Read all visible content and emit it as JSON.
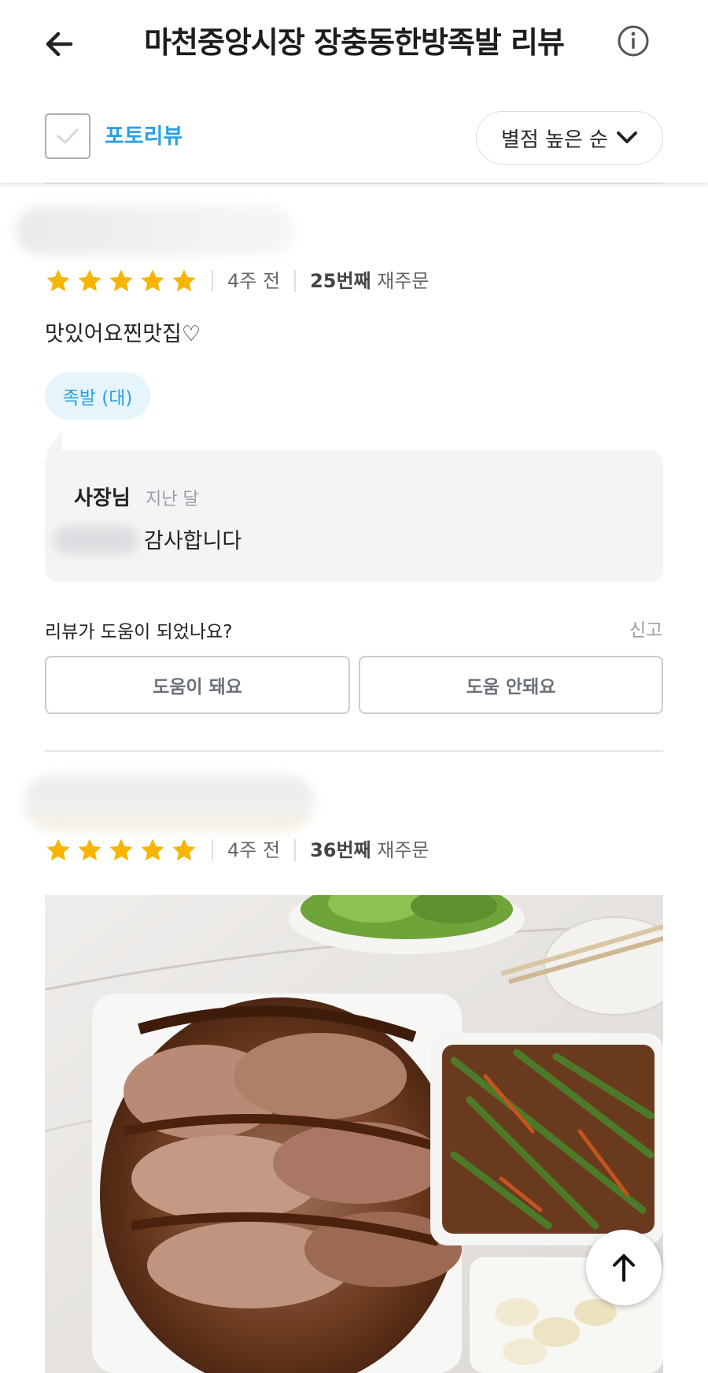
{
  "header": {
    "title": "마천중앙시장 장충동한방족발 리뷰",
    "back_icon": "arrow-left-icon",
    "info_icon": "info-circle-icon"
  },
  "filter": {
    "photo_review_label": "포토리뷰",
    "photo_review_checked": false,
    "sort_label": "별점 높은 순"
  },
  "colors": {
    "accent": "#2ba0e3",
    "star": "#f7b500",
    "owner_bg": "#f3f4f6"
  },
  "reviews": [
    {
      "rating": 5,
      "date": "4주 전",
      "reorder_count": "25번째",
      "reorder_suffix": "재주문",
      "text": "맛있어요찐맛집♡",
      "menu_tag": "족발 (대)",
      "owner_reply": {
        "name": "사장님",
        "date": "지난 달",
        "text": "감사합니다"
      },
      "helpful_question": "리뷰가 도움이 되었나요?",
      "report_label": "신고",
      "helpful_yes": "도움이 돼요",
      "helpful_no": "도움 안돼요"
    },
    {
      "rating": 5,
      "date": "4주 전",
      "reorder_count": "36번째",
      "reorder_suffix": "재주문"
    }
  ],
  "scroll_top_icon": "arrow-up-icon"
}
